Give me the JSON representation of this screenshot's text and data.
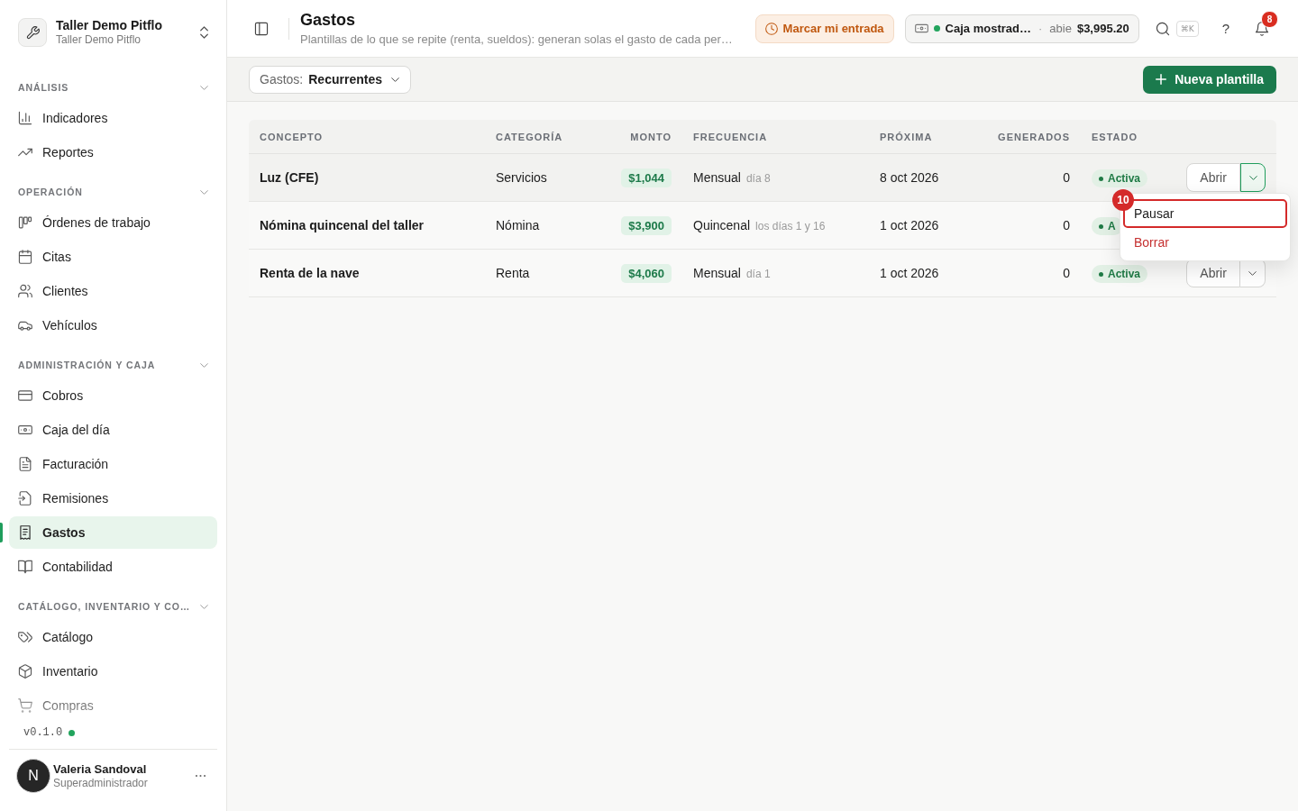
{
  "sidebar": {
    "workspace": {
      "name": "Taller Demo Pitflo",
      "subtitle": "Taller Demo Pitflo"
    },
    "sections": [
      {
        "title": "ANÁLISIS",
        "expanded": true,
        "items": [
          {
            "label": "Indicadores",
            "selected": false
          },
          {
            "label": "Reportes",
            "selected": false
          }
        ]
      },
      {
        "title": "OPERACIÓN",
        "expanded": true,
        "items": [
          {
            "label": "Órdenes de trabajo",
            "selected": false
          },
          {
            "label": "Citas",
            "selected": false
          },
          {
            "label": "Clientes",
            "selected": false
          },
          {
            "label": "Vehículos",
            "selected": false
          }
        ]
      },
      {
        "title": "ADMINISTRACIÓN Y CAJA",
        "expanded": true,
        "items": [
          {
            "label": "Cobros",
            "selected": false
          },
          {
            "label": "Caja del día",
            "selected": false
          },
          {
            "label": "Facturación",
            "selected": false
          },
          {
            "label": "Remisiones",
            "selected": false
          },
          {
            "label": "Gastos",
            "selected": true
          },
          {
            "label": "Contabilidad",
            "selected": false
          }
        ]
      },
      {
        "title": "CATÁLOGO, INVENTARIO Y CO…",
        "expanded": true,
        "items": [
          {
            "label": "Catálogo",
            "selected": false
          },
          {
            "label": "Inventario",
            "selected": false
          },
          {
            "label": "Compras",
            "selected": false
          }
        ]
      }
    ],
    "version": "v0.1.0",
    "user": {
      "initial": "N",
      "name": "Valeria Sandoval",
      "role": "Superadministrador"
    }
  },
  "header": {
    "title": "Gastos",
    "subtitle": "Plantillas de lo que se repite (renta, sueldos): generan solas el gasto de cada per…",
    "clock_in": "Marcar mi entrada",
    "cash_register": {
      "name": "Caja mostrad…",
      "separator": "·",
      "status": "abie",
      "amount": "$3,995.20",
      "open": true
    },
    "shortcut": "⌘K",
    "help": "?",
    "notifications": "8"
  },
  "toolbar": {
    "filter": {
      "label": "Gastos:",
      "value": "Recurrentes"
    },
    "new_button": "Nueva plantilla"
  },
  "table": {
    "columns": [
      "CONCEPTO",
      "CATEGORÍA",
      "MONTO",
      "FRECUENCIA",
      "PRÓXIMA",
      "GENERADOS",
      "ESTADO"
    ],
    "rows": [
      {
        "concept": "Luz (CFE)",
        "category": "Servicios",
        "amount": "$1,044",
        "frequency": "Mensual",
        "frequency_detail": "día 8",
        "next_date": "8 oct 2026",
        "generated": "0",
        "status": {
          "kind": "active",
          "label": "Activa"
        },
        "open_button": "Abrir",
        "hovered": true,
        "menu_open": true
      },
      {
        "concept": "Nómina quincenal del taller",
        "category": "Nómina",
        "amount": "$3,900",
        "frequency": "Quincenal",
        "frequency_detail": "los días 1 y 16",
        "next_date": "1 oct 2026",
        "generated": "0",
        "status": {
          "kind": "active",
          "label": "A"
        },
        "hovered": false,
        "menu_open": false
      },
      {
        "concept": "Renta de la nave",
        "category": "Renta",
        "amount": "$4,060",
        "frequency": "Mensual",
        "frequency_detail": "día 1",
        "next_date": "1 oct 2026",
        "generated": "0",
        "status": {
          "kind": "active",
          "label": "Activa"
        },
        "open_button": "Abrir",
        "hovered": false,
        "menu_open": false
      }
    ]
  },
  "row_menu": {
    "marker": "10",
    "items": [
      {
        "label": "Pausar",
        "kind": "default",
        "marked": true
      },
      {
        "label": "Borrar",
        "kind": "danger",
        "marked": false
      }
    ]
  }
}
